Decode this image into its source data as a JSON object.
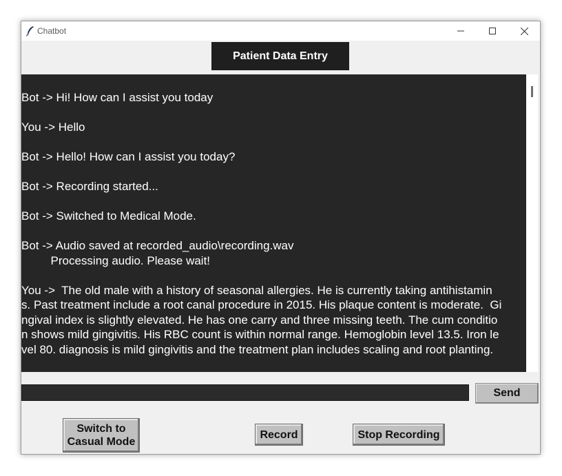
{
  "window": {
    "title": "Chatbot",
    "app_icon": "feather-icon",
    "controls": {
      "minimize": "minimize-icon",
      "maximize": "maximize-icon",
      "close": "close-icon"
    }
  },
  "header": {
    "title": "Patient Data Entry"
  },
  "chat": {
    "messages": [
      {
        "lines": [
          "Bot -> Hi! How can I assist you today"
        ]
      },
      {
        "lines": [
          "You -> Hello"
        ]
      },
      {
        "lines": [
          "Bot -> Hello! How can I assist you today?"
        ]
      },
      {
        "lines": [
          "Bot -> Recording started..."
        ]
      },
      {
        "lines": [
          "Bot -> Switched to Medical Mode."
        ]
      },
      {
        "lines": [
          "Bot -> Audio saved at recorded_audio\\recording.wav",
          "         Processing audio. Please wait!"
        ]
      },
      {
        "lines": [
          "You ->  The old male with a history of seasonal allergies. He is currently taking antihistamin",
          "s. Past treatment include a root canal procedure in 2015. His plaque content is moderate.  Gi",
          "ngival index is slightly elevated. He has one carry and three missing teeth. The cum conditio",
          "n shows mild gingivitis. His RBC count is within normal range. Hemoglobin level 13.5. Iron le",
          "vel 80. diagnosis is mild gingivitis and the treatment plan includes scaling and root planting."
        ]
      }
    ]
  },
  "input": {
    "value": "",
    "placeholder": ""
  },
  "buttons": {
    "send": "Send",
    "switch_mode": "Switch to\nCasual Mode",
    "record": "Record",
    "stop_recording": "Stop Recording"
  },
  "colors": {
    "chat_background": "#262626",
    "header_background": "#1f1f1f",
    "button_background": "#c0c0c0",
    "text": "#ffffff"
  }
}
